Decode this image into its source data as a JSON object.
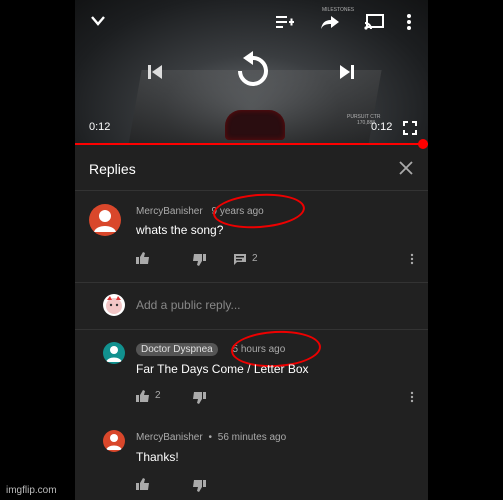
{
  "video": {
    "time_left": "0:12",
    "time_right": "0:12",
    "hud_milestones": "MILESTONES",
    "hud_pursuit": "PURSUIT CTR",
    "hud_pursuit_value": "170,888"
  },
  "replies": {
    "title": "Replies",
    "thread": {
      "author": "MercyBanisher",
      "time": "9 years ago",
      "text": "whats the song?",
      "reply_count": "2"
    },
    "input_placeholder": "Add a public reply...",
    "items": [
      {
        "author": "Doctor Dyspnea",
        "time": "5 hours ago",
        "text": "Far The Days Come / Letter Box",
        "likes": "2"
      },
      {
        "author": "MercyBanisher",
        "separator": "•",
        "time": "56 minutes ago",
        "text": "Thanks!"
      }
    ]
  },
  "watermark": "imgflip.com",
  "colors": {
    "accent": "#ff0000",
    "avatar_orange": "#d9472b",
    "avatar_teal": "#11918f"
  }
}
